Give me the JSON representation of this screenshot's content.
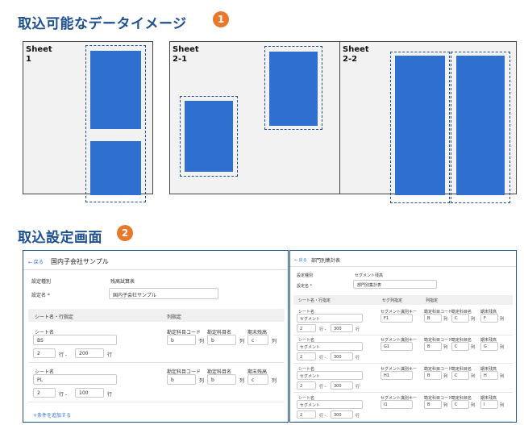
{
  "section1": {
    "title": "取込可能なデータイメージ",
    "badge": "1"
  },
  "section2": {
    "title": "取込設定画面",
    "badge": "2"
  },
  "sheets": {
    "s1": "Sheet\n1",
    "s21": "Sheet\n2-1",
    "s22": "Sheet\n2-2"
  },
  "left": {
    "back": "← 戻る",
    "title": "国内子会社サンプル",
    "setting_type_label": "設定種別",
    "setting_type_value": "残高試算表",
    "setting_name_label": "設定名 *",
    "setting_name_value": "国内子会社サンプル",
    "sheet_header": "シート名・行指定",
    "col_header": "列指定",
    "rows": [
      {
        "sheet_label": "シート名",
        "sheet_value": "BS",
        "row_from": "2",
        "row_sep": "行 -",
        "row_to": "200",
        "row_unit": "行",
        "c1_label": "勘定科目コード",
        "c1_value": "b",
        "c2_label": "勘定科目名",
        "c2_value": "b",
        "c3_label": "期末残高",
        "c3_value": "c",
        "col_unit": "列"
      },
      {
        "sheet_label": "シート名",
        "sheet_value": "PL",
        "row_from": "2",
        "row_sep": "行 -",
        "row_to": "100",
        "row_unit": "行",
        "c1_label": "勘定科目コード",
        "c1_value": "b",
        "c2_label": "勘定科目名",
        "c2_value": "b",
        "c3_label": "期末残高",
        "c3_value": "c",
        "col_unit": "列"
      }
    ],
    "add_condition": "+条件を追加する"
  },
  "right": {
    "back": "← 戻る",
    "title": "部門別集計表",
    "setting_type_label": "設定種別",
    "setting_type_value": "セグメント残高",
    "setting_name_label": "設定名 *",
    "setting_name_value": "部門別集計表",
    "sheet_header": "シート名・行指定",
    "seg_header": "セグ列指定",
    "col_header": "列指定",
    "rows": [
      {
        "sheet_label": "シート名",
        "sheet_value": "セグメント",
        "row_from": "2",
        "row_sep": "行 -",
        "row_to": "300",
        "row_unit": "行",
        "seg_label": "セグメント識別キー",
        "seg_value": "F1",
        "c1_label": "勘定科目コード",
        "c1_value": "B",
        "c2_label": "勘定科目名",
        "c2_value": "C",
        "c3_label": "期末残高",
        "c3_value": "F",
        "col_unit": "列"
      },
      {
        "sheet_label": "シート名",
        "sheet_value": "セグメント",
        "row_from": "2",
        "row_sep": "行 -",
        "row_to": "300",
        "row_unit": "行",
        "seg_label": "セグメント識別キー",
        "seg_value": "G1",
        "c1_label": "勘定科目コード",
        "c1_value": "B",
        "c2_label": "勘定科目名",
        "c2_value": "C",
        "c3_label": "期末残高",
        "c3_value": "G",
        "col_unit": "列"
      },
      {
        "sheet_label": "シート名",
        "sheet_value": "セグメント",
        "row_from": "2",
        "row_sep": "行 -",
        "row_to": "300",
        "row_unit": "行",
        "seg_label": "セグメント識別キー",
        "seg_value": "H1",
        "c1_label": "勘定科目コード",
        "c1_value": "B",
        "c2_label": "勘定科目名",
        "c2_value": "C",
        "c3_label": "期末残高",
        "c3_value": "H",
        "col_unit": "列"
      },
      {
        "sheet_label": "シート名",
        "sheet_value": "セグメント",
        "row_from": "2",
        "row_sep": "行 -",
        "row_to": "300",
        "row_unit": "行",
        "seg_label": "セグメント識別キー",
        "seg_value": "I1",
        "c1_label": "勘定科目コード",
        "c1_value": "B",
        "c2_label": "勘定科目名",
        "c2_value": "C",
        "c3_label": "期末残高",
        "c3_value": "I",
        "col_unit": "列"
      }
    ]
  }
}
